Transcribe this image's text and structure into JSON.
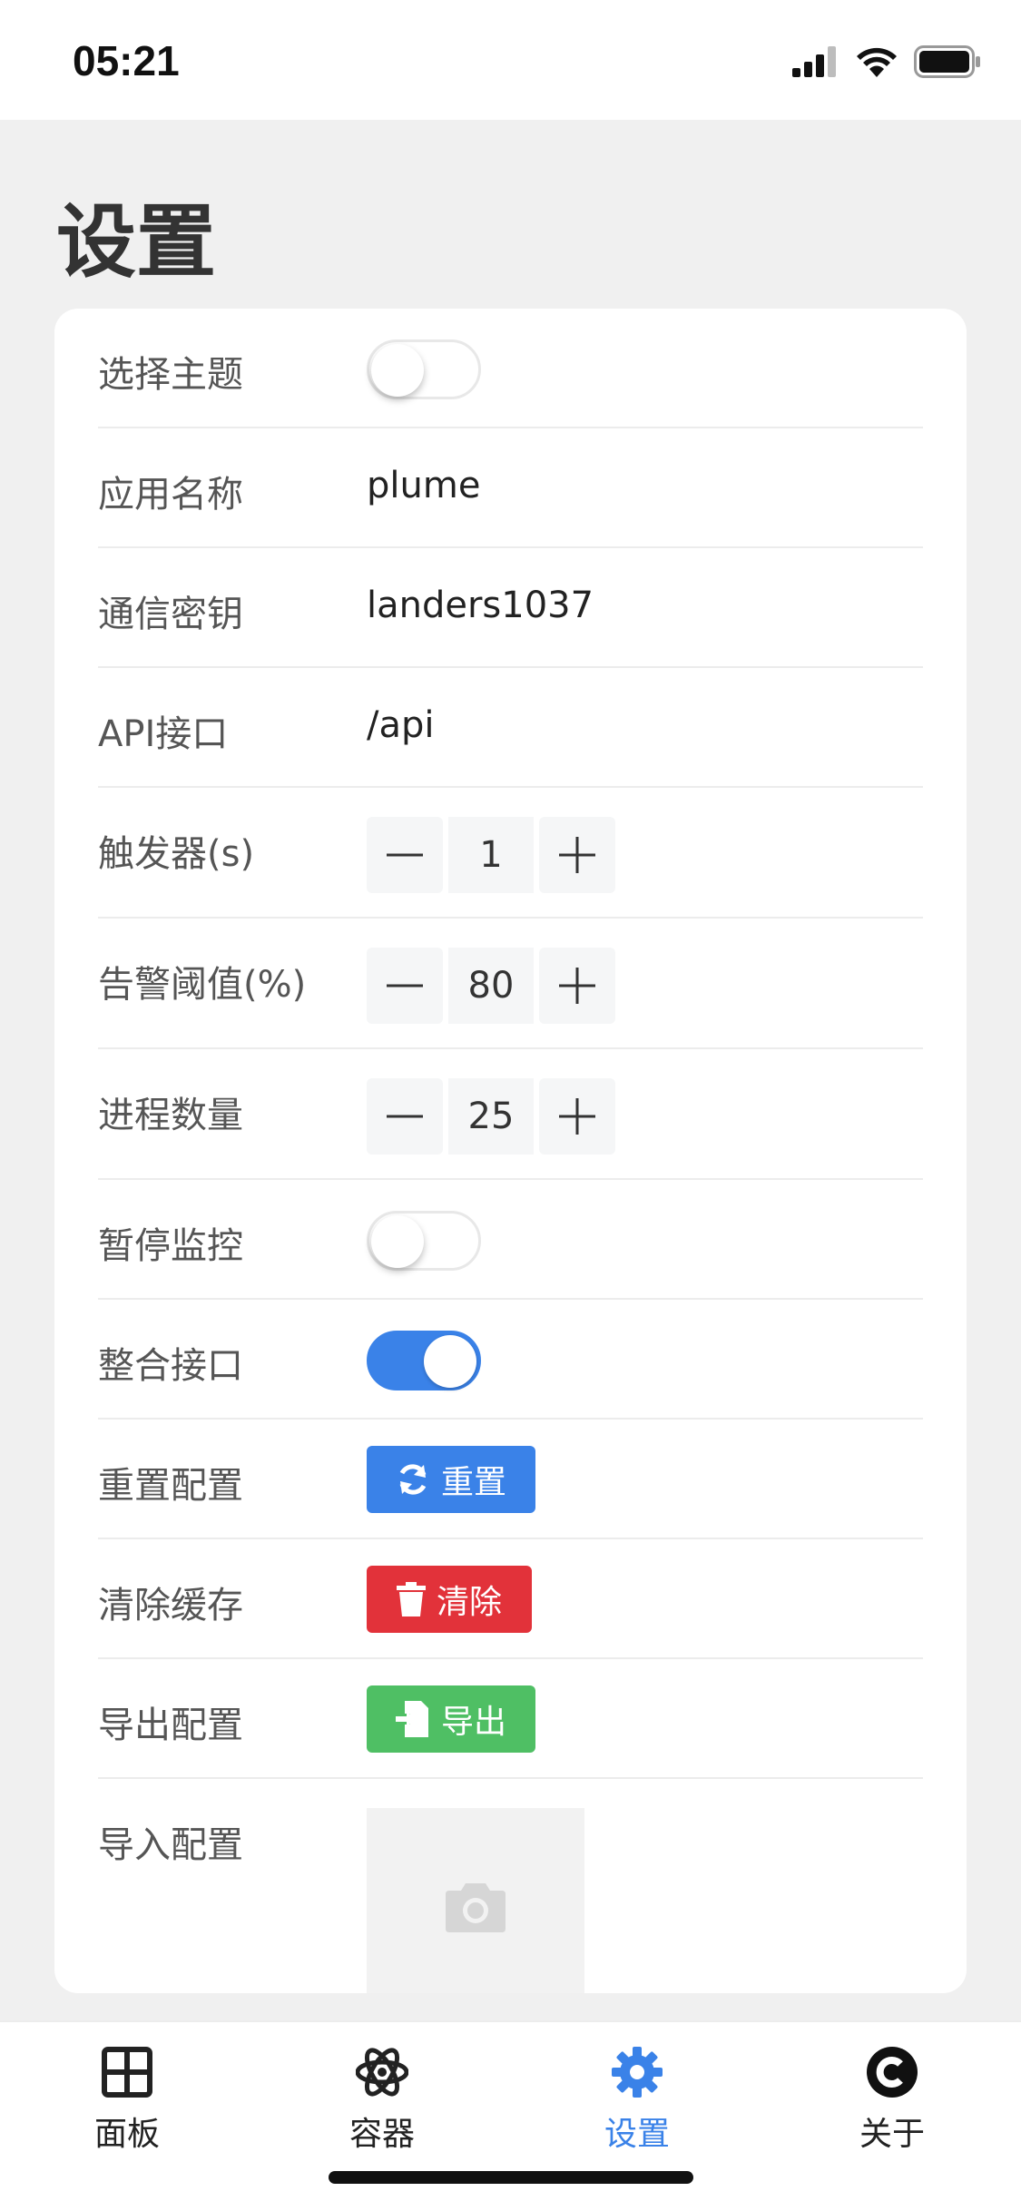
{
  "status_bar": {
    "time": "05:21"
  },
  "page": {
    "title": "设置"
  },
  "settings": {
    "theme": {
      "label": "选择主题",
      "on": false
    },
    "app_name": {
      "label": "应用名称",
      "value": "plume"
    },
    "secret": {
      "label": "通信密钥",
      "value": "landers1037"
    },
    "api": {
      "label": "API接口",
      "value": "/api"
    },
    "trigger": {
      "label": "触发器(s)",
      "value": "1"
    },
    "alert": {
      "label": "告警阈值(%)",
      "value": "80"
    },
    "process": {
      "label": "进程数量",
      "value": "25"
    },
    "pause": {
      "label": "暂停监控",
      "on": false
    },
    "merge": {
      "label": "整合接口",
      "on": true
    },
    "reset": {
      "label": "重置配置",
      "button": "重置"
    },
    "clear": {
      "label": "清除缓存",
      "button": "清除"
    },
    "export": {
      "label": "导出配置",
      "button": "导出"
    },
    "import": {
      "label": "导入配置"
    }
  },
  "tabbar": {
    "tabs": [
      {
        "label": "面板",
        "icon": "grid-icon"
      },
      {
        "label": "容器",
        "icon": "atom-icon"
      },
      {
        "label": "设置",
        "icon": "gear-icon",
        "active": true
      },
      {
        "label": "关于",
        "icon": "c-circle-icon"
      }
    ]
  },
  "colors": {
    "accent": "#3a82e8",
    "danger": "#e2323a",
    "success": "#4fbf64"
  }
}
